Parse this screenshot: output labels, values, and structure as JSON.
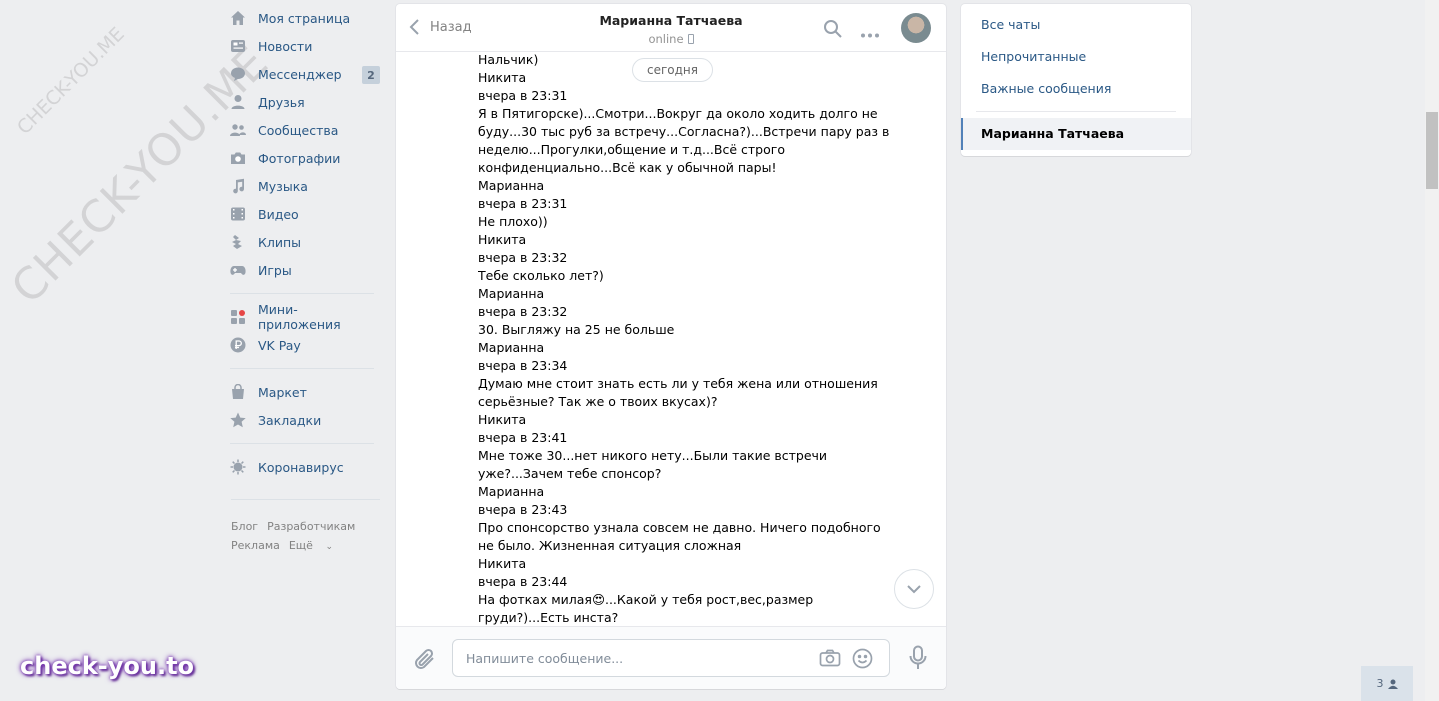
{
  "sidebar": {
    "items": [
      {
        "label": "Моя страница",
        "icon": "home-icon"
      },
      {
        "label": "Новости",
        "icon": "news-icon"
      },
      {
        "label": "Мессенджер",
        "icon": "messenger-icon",
        "badge": "2"
      },
      {
        "label": "Друзья",
        "icon": "friends-icon"
      },
      {
        "label": "Сообщества",
        "icon": "communities-icon"
      },
      {
        "label": "Фотографии",
        "icon": "photos-icon"
      },
      {
        "label": "Музыка",
        "icon": "music-icon"
      },
      {
        "label": "Видео",
        "icon": "video-icon"
      },
      {
        "label": "Клипы",
        "icon": "clips-icon"
      },
      {
        "label": "Игры",
        "icon": "games-icon"
      }
    ],
    "items2": [
      {
        "label": "Мини-приложения",
        "icon": "mini-apps-icon"
      },
      {
        "label": "VK Pay",
        "icon": "vk-pay-icon"
      }
    ],
    "items3": [
      {
        "label": "Маркет",
        "icon": "market-icon"
      },
      {
        "label": "Закладки",
        "icon": "bookmarks-icon"
      }
    ],
    "items4": [
      {
        "label": "Коронавирус",
        "icon": "coronavirus-icon"
      }
    ],
    "footer": {
      "blog": "Блог",
      "developers": "Разработчикам",
      "ads": "Реклама",
      "more": "Ещё"
    }
  },
  "chat": {
    "back_label": "Назад",
    "peer_name": "Марианна Татчаева",
    "peer_status": "online",
    "date_pill": "сегодня",
    "input_placeholder": "Напишите сообщение...",
    "lines": [
      "Нальчик)",
      "Никита",
      "вчера в 23:31",
      "Я в Пятигорске)...Смотри...Вокруг да около ходить долго не",
      "буду...30 тыс руб за встречу...Согласна?)...Встречи пару раз в",
      "неделю...Прогулки,общение и т.д...Всё строго",
      "конфиденциально...Всё как у обычной пары!",
      "Марианна",
      "вчера в 23:31",
      "Не плохо))",
      "Никита",
      "вчера в 23:32",
      "Тебе сколько лет?)",
      "Марианна",
      "вчера в 23:32",
      "30. Выгляжу на 25 не больше",
      "Марианна",
      "вчера в 23:34",
      "Думаю мне стоит знать есть ли у тебя жена или отношения",
      "серьёзные? Так же о твоих вкусах)?",
      "Никита",
      "вчера в 23:41",
      "Мне тоже 30...нет никого нету...Были такие встречи",
      "уже?...Зачем тебе спонсор?",
      "Марианна",
      "вчера в 23:43",
      "Про спонсорство узнала совсем не давно. Ничего подобного",
      "не было. Жизненная ситуация сложная",
      "Никита",
      "вчера в 23:44",
      "На фотках милая😍...Какой у тебя рост,вес,размер",
      "груди?)...Есть инста?"
    ]
  },
  "right_panel": {
    "all_chats": "Все чаты",
    "unread": "Непрочитанные",
    "important": "Важные сообщения",
    "active_chat": "Марианна Татчаева"
  },
  "friends_online": "3",
  "watermarks": {
    "diagonal_big": "CHECK-YOU.ME",
    "diagonal_small": "CHECK-YOU.ME",
    "logo": "check-you.to"
  }
}
